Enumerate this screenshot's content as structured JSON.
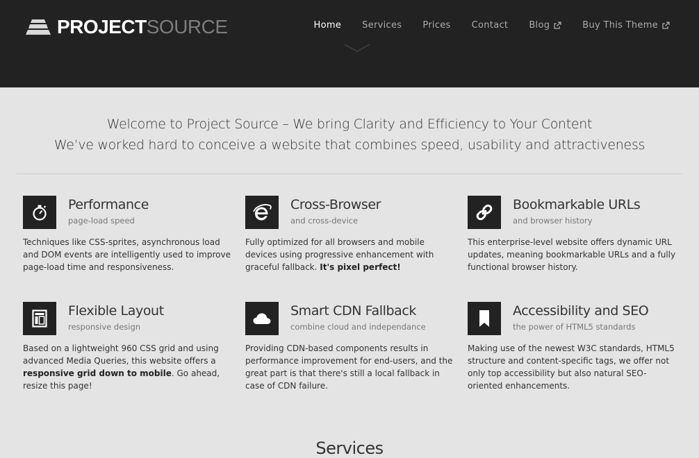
{
  "logo": {
    "part1": "PROJECT",
    "part2": "SOURCE"
  },
  "nav": [
    {
      "label": "Home",
      "active": true,
      "external": false
    },
    {
      "label": "Services",
      "active": false,
      "external": false
    },
    {
      "label": "Prices",
      "active": false,
      "external": false
    },
    {
      "label": "Contact",
      "active": false,
      "external": false
    },
    {
      "label": "Blog",
      "active": false,
      "external": true
    },
    {
      "label": "Buy This Theme",
      "active": false,
      "external": true
    }
  ],
  "intro": {
    "line1": "Welcome to Project Source – We bring Clarity and Efficiency to Your Content",
    "line2": "We’ve worked hard to conceive a website that combines speed, usability and attractiveness"
  },
  "features": [
    {
      "icon": "stopwatch-icon",
      "title": "Performance",
      "subtitle": "page-load speed",
      "desc": "Techniques like CSS-sprites, asynchronous load and DOM events are intelligently used to improve page-load time and responsiveness.",
      "desc_bold": "",
      "desc_after": ""
    },
    {
      "icon": "browser-e-icon",
      "title": "Cross-Browser",
      "subtitle": "and cross-device",
      "desc": "Fully optimized for all browsers and mobile devices using progressive enhancement with graceful fallback. ",
      "desc_bold": "It's pixel perfect!",
      "desc_after": ""
    },
    {
      "icon": "link-icon",
      "title": "Bookmarkable URLs",
      "subtitle": "and browser history",
      "desc": "This enterprise-level website offers dynamic URL updates, meaning bookmarkable URLs and a fully functional browser history.",
      "desc_bold": "",
      "desc_after": ""
    },
    {
      "icon": "layout-icon",
      "title": "Flexible Layout",
      "subtitle": "responsive design",
      "desc": "Based on a lightweight 960 CSS grid and using advanced Media Queries, this website offers a ",
      "desc_bold": "responsive grid down to mobile",
      "desc_after": ". Go ahead, resize this page!"
    },
    {
      "icon": "cloud-icon",
      "title": "Smart CDN Fallback",
      "subtitle": "combine cloud and independance",
      "desc": "Providing CDN-based components results in performance improvement for end-users, and the great part is that there's still a local fallback in case of CDN failure.",
      "desc_bold": "",
      "desc_after": ""
    },
    {
      "icon": "bookmark-icon",
      "title": "Accessibility and SEO",
      "subtitle": "the power of HTML5 standards",
      "desc": "Making use of the newest W3C standards, HTML5 structure and content-specific tags, we offer not only top accessibility but also natural SEO-oriented enhancements.",
      "desc_bold": "",
      "desc_after": ""
    }
  ],
  "services_heading": "Services"
}
